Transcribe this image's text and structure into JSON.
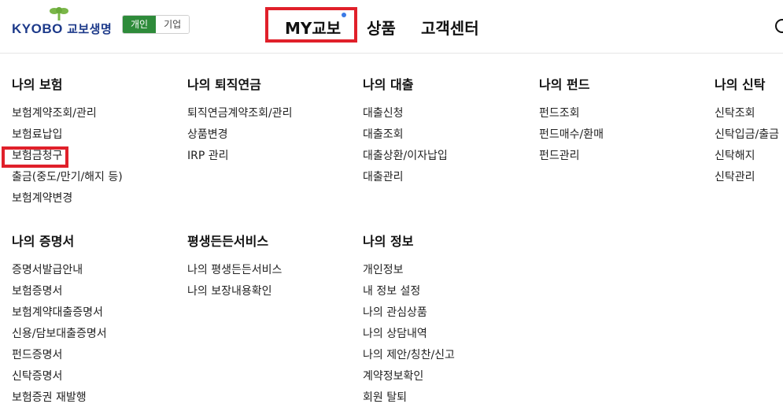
{
  "header": {
    "logo": {
      "brand": "KYOBO",
      "name": "교보생명"
    },
    "segment": [
      "개인",
      "기업"
    ],
    "nav": [
      "MY교보",
      "상품",
      "고객센터"
    ]
  },
  "menu": {
    "row1": [
      {
        "title": "나의 보험",
        "items": [
          "보험계약조회/관리",
          "보험료납입",
          "보험금청구",
          "출금(중도/만기/해지 등)",
          "보험계약변경"
        ]
      },
      {
        "title": "나의 퇴직연금",
        "items": [
          "퇴직연금계약조회/관리",
          "상품변경",
          "IRP 관리"
        ]
      },
      {
        "title": "나의 대출",
        "items": [
          "대출신청",
          "대출조회",
          "대출상환/이자납입",
          "대출관리"
        ]
      },
      {
        "title": "나의 펀드",
        "items": [
          "펀드조회",
          "펀드매수/환매",
          "펀드관리"
        ]
      },
      {
        "title": "나의 신탁",
        "items": [
          "신탁조회",
          "신탁입금/출금",
          "신탁해지",
          "신탁관리"
        ]
      }
    ],
    "row2": [
      {
        "title": "나의 증명서",
        "items": [
          "증명서발급안내",
          "보험증명서",
          "보험계약대출증명서",
          "신용/담보대출증명서",
          "펀드증명서",
          "신탁증명서",
          "보험증권 재발행"
        ]
      },
      {
        "title": "평생든든서비스",
        "items": [
          "나의 평생든든서비스",
          "나의 보장내용확인"
        ]
      },
      {
        "title": "나의 정보",
        "items": [
          "개인정보",
          "내 정보 설정",
          "나의 관심상품",
          "나의 상담내역",
          "나의 제안/칭찬/신고",
          "계약정보확인",
          "회원 탈퇴"
        ]
      }
    ]
  },
  "colors": {
    "accent_green": "#2e8b3a",
    "brand_blue": "#1d3a8a",
    "highlight_red": "#e0202a",
    "notify_blue": "#3b7ae6"
  }
}
